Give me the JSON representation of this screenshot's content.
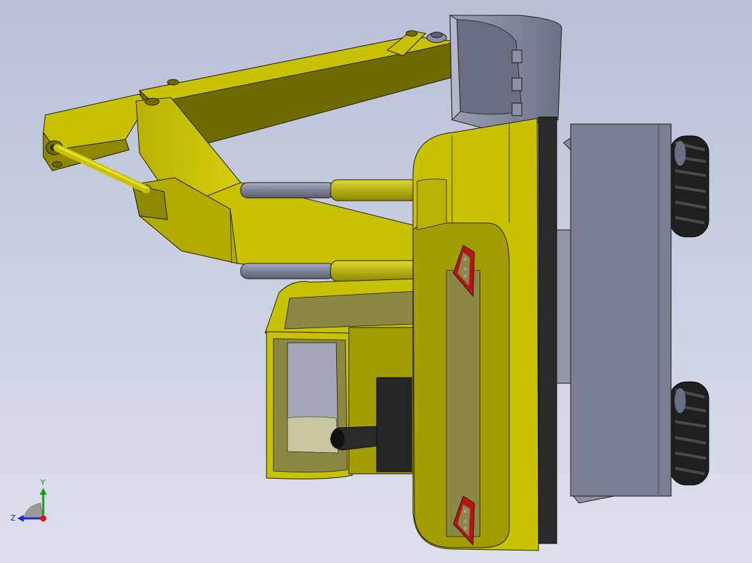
{
  "viewport": {
    "colors": {
      "background_top": "#b9bfd6",
      "background_bottom": "#dde0ec",
      "body_yellow": "#c9c200",
      "body_yellow_dark": "#6e6a00",
      "body_yellow_mid": "#a39d00",
      "panel_olive": "#8a8843",
      "steel": "#8a8ea6",
      "steel_dark": "#5f6276",
      "blade": "#7a7e95",
      "tire": "#1f1f1f",
      "reflector_red": "#b81414",
      "edge": "#1c1c08"
    }
  },
  "triad": {
    "y_label": "Y",
    "z_label": "Z",
    "colors": {
      "y_axis": "#1a9a1a",
      "z_axis": "#1a2ad0",
      "origin": "#d01a1a"
    }
  }
}
